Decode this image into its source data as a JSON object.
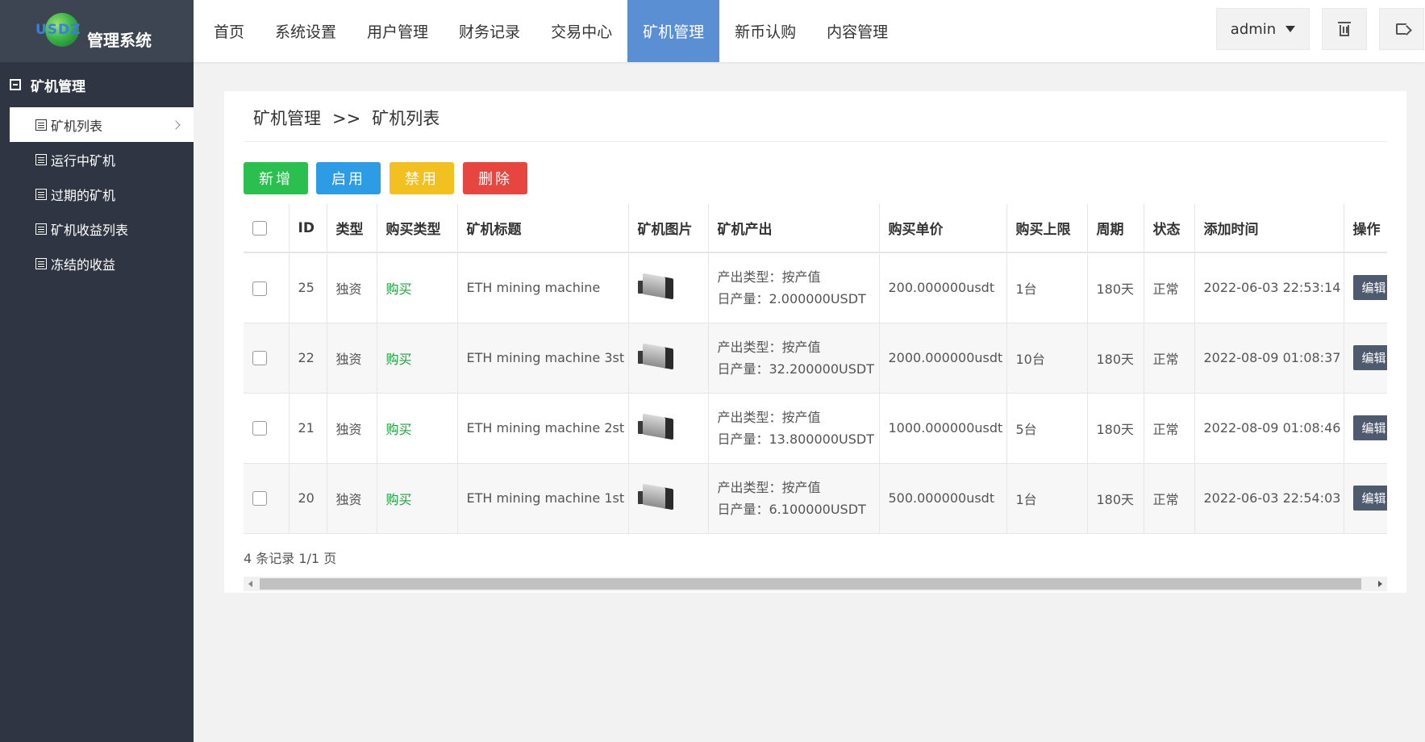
{
  "logo": {
    "letters": "USDZ",
    "title": "管理系统"
  },
  "nav": {
    "items": [
      "首页",
      "系统设置",
      "用户管理",
      "财务记录",
      "交易中心",
      "矿机管理",
      "新币认购",
      "内容管理"
    ],
    "active_index": 5,
    "user": "admin"
  },
  "sidebar": {
    "group": "矿机管理",
    "items": [
      {
        "label": "矿机列表",
        "active": true
      },
      {
        "label": "运行中矿机"
      },
      {
        "label": "过期的矿机"
      },
      {
        "label": "矿机收益列表"
      },
      {
        "label": "冻结的收益"
      }
    ]
  },
  "breadcrumb": {
    "parent": "矿机管理",
    "sep": ">>",
    "current": "矿机列表"
  },
  "toolbar": {
    "add": "新增",
    "enable": "启用",
    "disable": "禁用",
    "delete": "删除"
  },
  "table": {
    "headers": [
      "ID",
      "类型",
      "购买类型",
      "矿机标题",
      "矿机图片",
      "矿机产出",
      "购买单价",
      "购买上限",
      "周期",
      "状态",
      "添加时间",
      "操作"
    ],
    "rows": [
      {
        "id": "25",
        "type": "独资",
        "buy_type": "购买",
        "title": "ETH mining machine",
        "out_type": "产出类型：按产值",
        "out_daily": "日产量：2.000000USDT",
        "price": "200.000000usdt",
        "limit": "1台",
        "cycle": "180天",
        "status": "正常",
        "time": "2022-06-03 22:53:14",
        "action": "编辑"
      },
      {
        "id": "22",
        "type": "独资",
        "buy_type": "购买",
        "title": "ETH mining machine 3st",
        "out_type": "产出类型：按产值",
        "out_daily": "日产量：32.200000USDT",
        "price": "2000.000000usdt",
        "limit": "10台",
        "cycle": "180天",
        "status": "正常",
        "time": "2022-08-09 01:08:37",
        "action": "编辑"
      },
      {
        "id": "21",
        "type": "独资",
        "buy_type": "购买",
        "title": "ETH mining machine 2st",
        "out_type": "产出类型：按产值",
        "out_daily": "日产量：13.800000USDT",
        "price": "1000.000000usdt",
        "limit": "5台",
        "cycle": "180天",
        "status": "正常",
        "time": "2022-08-09 01:08:46",
        "action": "编辑"
      },
      {
        "id": "20",
        "type": "独资",
        "buy_type": "购买",
        "title": "ETH mining machine 1st",
        "out_type": "产出类型：按产值",
        "out_daily": "日产量：6.100000USDT",
        "price": "500.000000usdt",
        "limit": "1台",
        "cycle": "180天",
        "status": "正常",
        "time": "2022-06-03 22:54:03",
        "action": "编辑"
      }
    ]
  },
  "pagination": {
    "summary": "4 条记录 1/1 页"
  }
}
